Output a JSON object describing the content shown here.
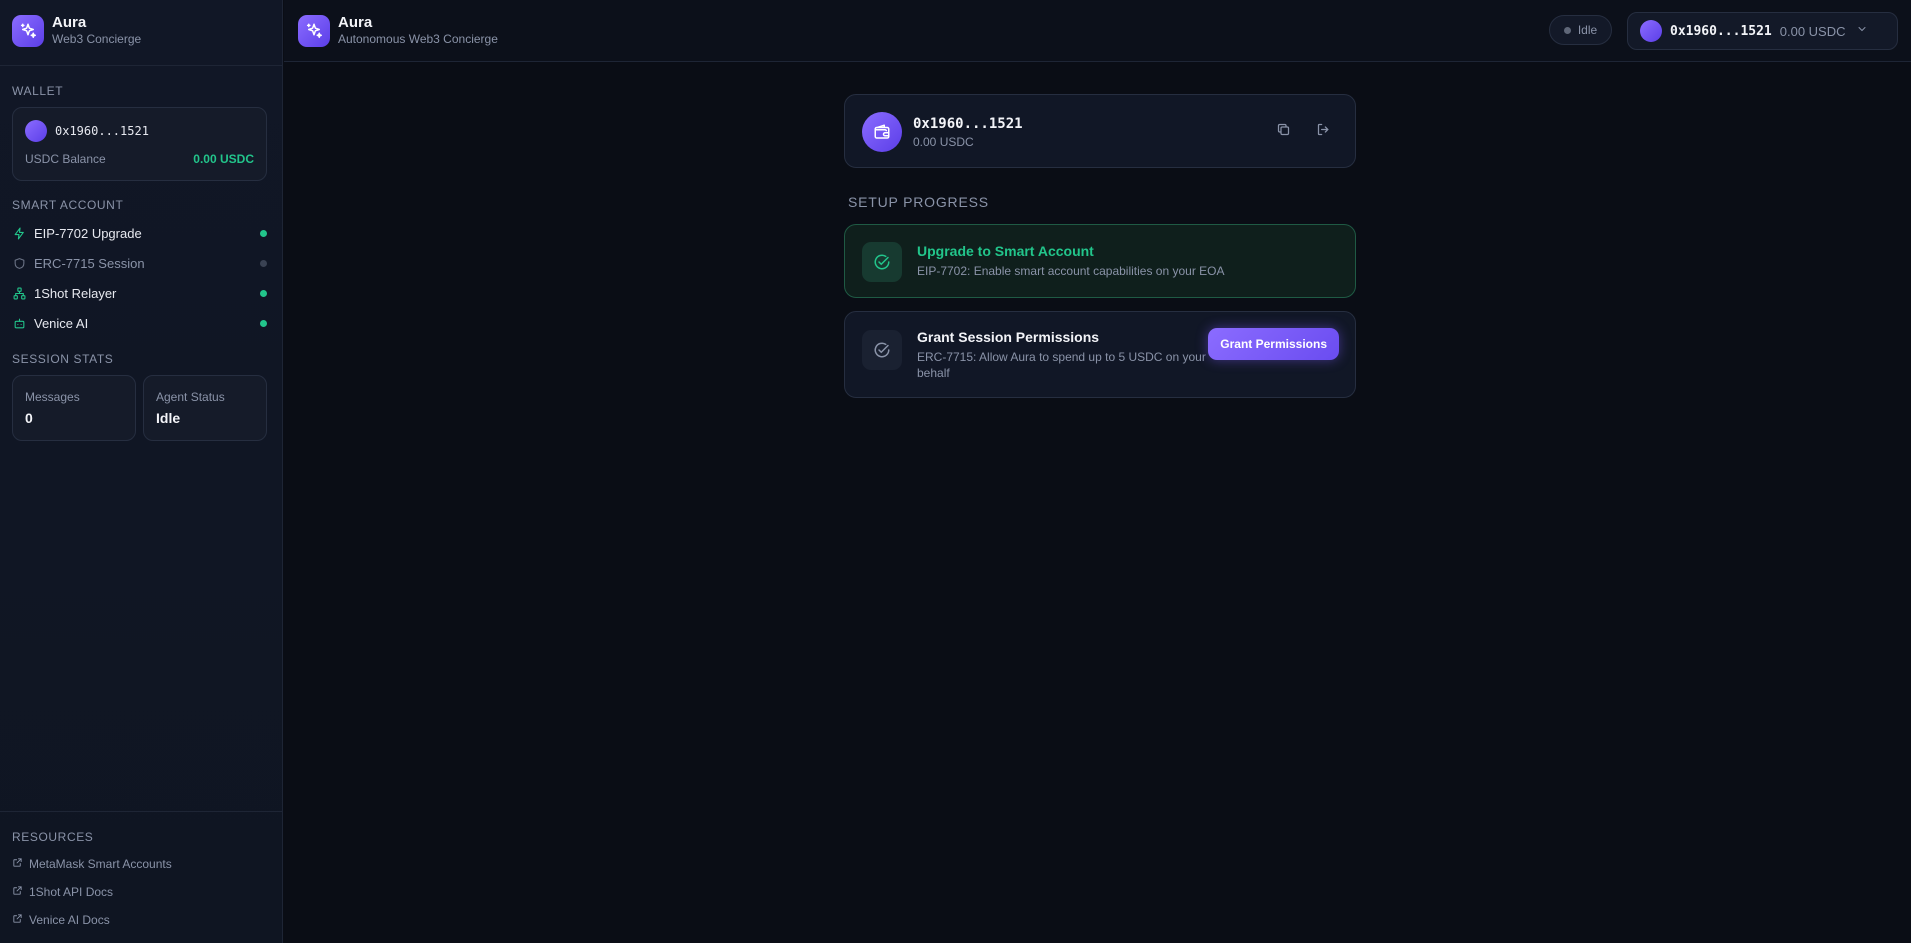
{
  "sidebar": {
    "brand": {
      "title": "Aura",
      "subtitle": "Web3 Concierge"
    },
    "wallet": {
      "section_label": "WALLET",
      "address": "0x1960...1521",
      "balance_label": "USDC Balance",
      "balance_value": "0.00 USDC"
    },
    "smart_account": {
      "section_label": "SMART ACCOUNT",
      "items": [
        {
          "label": "EIP-7702 Upgrade",
          "icon": "lightning-icon",
          "active": true
        },
        {
          "label": "ERC-7715 Session",
          "icon": "shield-icon",
          "active": false
        },
        {
          "label": "1Shot Relayer",
          "icon": "network-icon",
          "active": true
        },
        {
          "label": "Venice AI",
          "icon": "robot-icon",
          "active": true
        }
      ]
    },
    "session_stats": {
      "section_label": "SESSION STATS",
      "messages_label": "Messages",
      "messages_value": "0",
      "agent_status_label": "Agent Status",
      "agent_status_value": "Idle"
    },
    "resources": {
      "section_label": "RESOURCES",
      "links": [
        {
          "label": "MetaMask Smart Accounts"
        },
        {
          "label": "1Shot API Docs"
        },
        {
          "label": "Venice AI Docs"
        }
      ]
    }
  },
  "header": {
    "title": "Aura",
    "subtitle": "Autonomous Web3 Concierge",
    "status": "Idle",
    "account_address": "0x1960...1521",
    "account_balance": "0.00 USDC"
  },
  "main": {
    "wallet_card": {
      "address": "0x1960...1521",
      "balance": "0.00 USDC"
    },
    "setup_label": "SETUP PROGRESS",
    "steps": [
      {
        "title": "Upgrade to Smart Account",
        "description": "EIP-7702: Enable smart account capabilities on your EOA",
        "completed": true
      },
      {
        "title": "Grant Session Permissions",
        "description": "ERC-7715: Allow Aura to spend up to 5 USDC on your behalf",
        "completed": false,
        "button_label": "Grant Permissions"
      }
    ]
  },
  "colors": {
    "accent": "#7c5cff",
    "success": "#22c58b",
    "background": "#0a0d15",
    "muted_text": "#8a93a8"
  }
}
